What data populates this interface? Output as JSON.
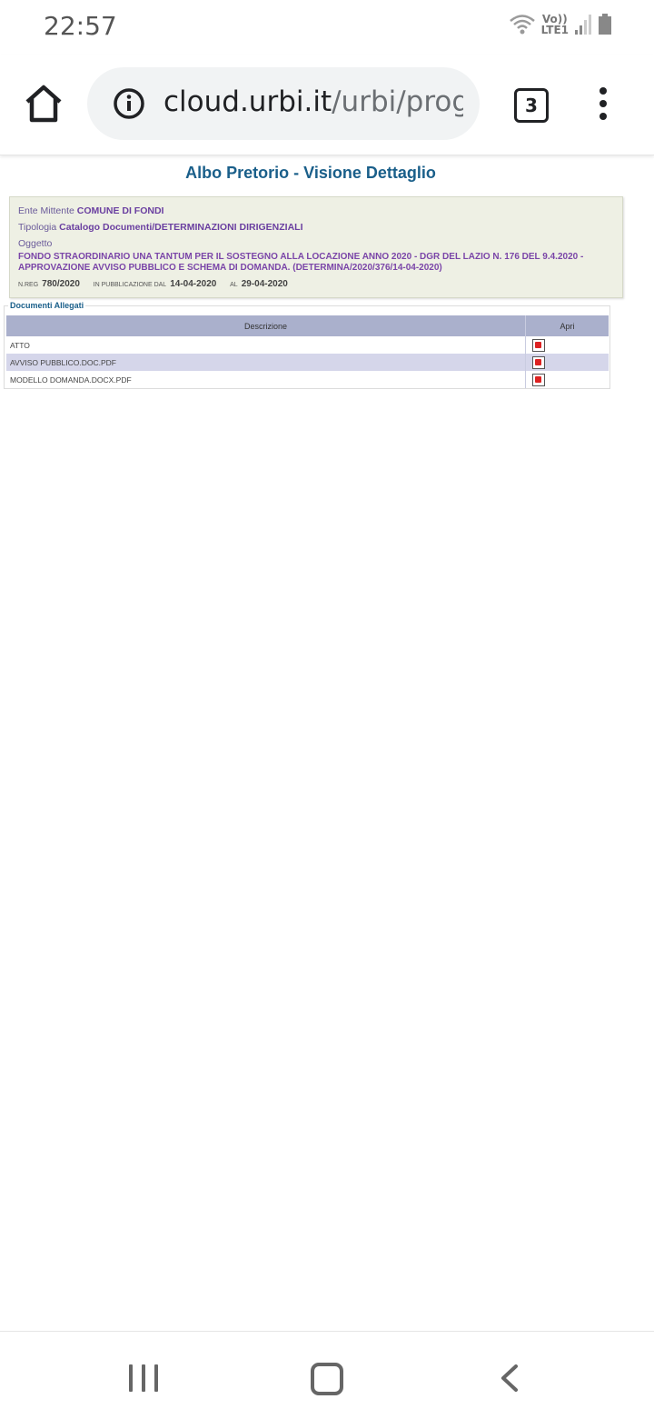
{
  "status_bar": {
    "time": "22:57",
    "network_top": "Vo))",
    "network_bottom": "LTE1"
  },
  "browser": {
    "url_host": "cloud.urbi.it",
    "url_path": "/urbi/progs",
    "tab_count": "3"
  },
  "page": {
    "title": "Albo Pretorio - Visione Dettaglio",
    "ente_label": "Ente Mittente",
    "ente_value": "COMUNE DI FONDI",
    "tipologia_label": "Tipologia",
    "tipologia_value": "Catalogo Documenti/DETERMINAZIONI DIRIGENZIALI",
    "oggetto_label": "Oggetto",
    "oggetto_value": "FONDO STRAORDINARIO UNA TANTUM PER IL SOSTEGNO ALLA LOCAZIONE ANNO 2020 - DGR DEL LAZIO N. 176 DEL 9.4.2020 - APPROVAZIONE AVVISO PUBBLICO E SCHEMA DI DOMANDA. (DETERMINA/2020/376/14-04-2020)",
    "nreg_label": "N.REG",
    "nreg_value": "780/2020",
    "pub_label": "IN PUBBLICAZIONE DAL",
    "pub_from": "14-04-2020",
    "al_label": "AL",
    "pub_to": "29-04-2020"
  },
  "documents": {
    "legend": "Documenti Allegati",
    "col_desc": "Descrizione",
    "col_open": "Apri",
    "rows": [
      {
        "name": "ATTO"
      },
      {
        "name": "AVVISO PUBBLICO.DOC.PDF"
      },
      {
        "name": "MODELLO DOMANDA.DOCX.PDF"
      }
    ]
  },
  "colors": {
    "title": "#1a5f8a",
    "box_bg": "#eef0e4",
    "header_bg": "#aab0cc",
    "alt_row": "#d5d6ea"
  }
}
